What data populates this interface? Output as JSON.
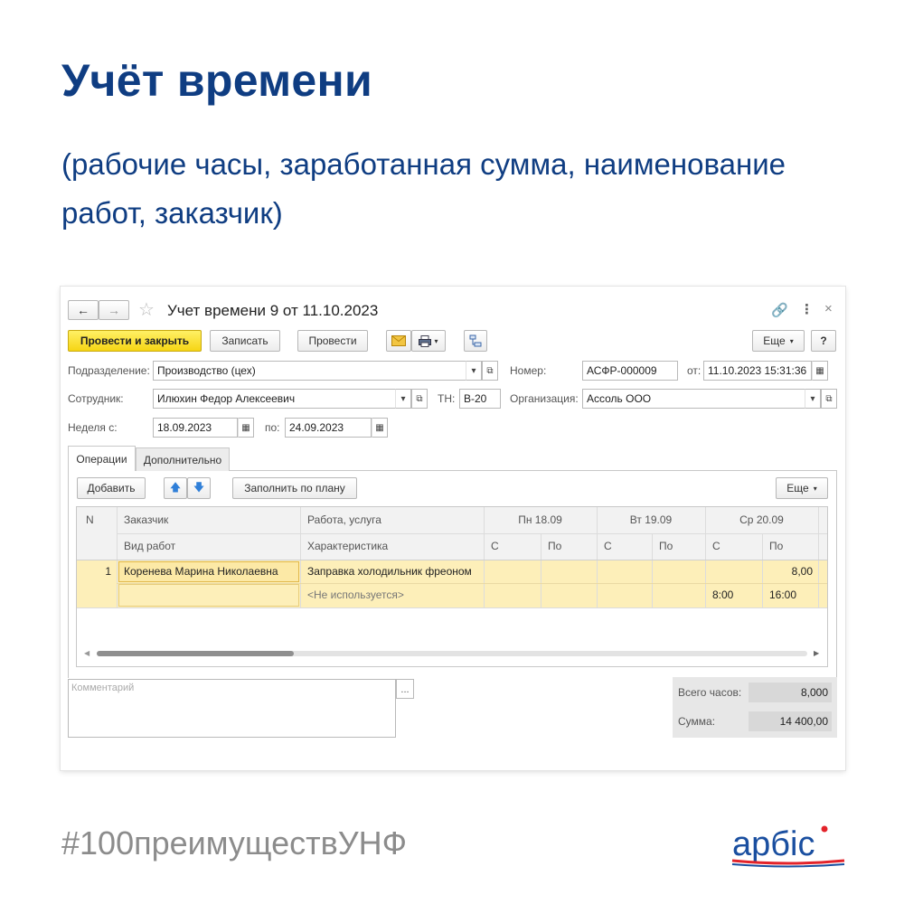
{
  "page": {
    "title": "Учёт времени",
    "subtitle": "(рабочие часы, заработанная сумма, наименование работ, заказчик)",
    "hashtag": "#100преимуществУНФ",
    "logo_text": "арбіс",
    "colors": {
      "title": "#0f3d82",
      "accent_red": "#e3232a",
      "primary_button": "#f6d514",
      "row_highlight": "#fdefb9"
    }
  },
  "window": {
    "title": "Учет времени 9 от 11.10.2023",
    "icons": [
      "arrow-left-icon",
      "arrow-right-icon",
      "star-icon",
      "link-icon",
      "more-icon",
      "close-icon"
    ]
  },
  "toolbar": {
    "post_close": "Провести и закрыть",
    "save": "Записать",
    "post": "Провести",
    "more": "Еще",
    "help": "?"
  },
  "form": {
    "division_label": "Подразделение:",
    "division_value": "Производство (цех)",
    "number_label": "Номер:",
    "number_value": "АСФР-000009",
    "from_label": "от:",
    "date_value": "11.10.2023 15:31:36",
    "employee_label": "Сотрудник:",
    "employee_value": "Илюхин Федор Алексеевич",
    "tn_label": "ТН:",
    "tn_value": "В-20",
    "org_label": "Организация:",
    "org_value": "Ассоль ООО",
    "week_label": "Неделя с:",
    "week_from": "18.09.2023",
    "to_label": "по:",
    "week_to": "24.09.2023"
  },
  "tabs": [
    "Операции",
    "Дополнительно"
  ],
  "table_toolbar": {
    "add": "Добавить",
    "fill": "Заполнить по плану",
    "more": "Еще"
  },
  "table": {
    "headers": {
      "n": "N",
      "customer": "Заказчик",
      "work": "Работа, услуга",
      "work_type": "Вид работ",
      "characteristic": "Характеристика",
      "day1": "Пн 18.09",
      "day2": "Вт 19.09",
      "day3": "Ср 20.09",
      "from": "С",
      "to": "По"
    },
    "row": {
      "n": "1",
      "customer": "Коренева Марина Николаевна",
      "work": "Заправка холодильник фреоном",
      "characteristic": "<Не используется>",
      "day3_hours": "8,00",
      "day3_from": "8:00",
      "day3_to": "16:00"
    }
  },
  "comment": {
    "placeholder": "Комментарий",
    "button": "..."
  },
  "totals": {
    "hours_label": "Всего часов:",
    "hours_value": "8,000",
    "sum_label": "Сумма:",
    "sum_value": "14 400,00"
  }
}
